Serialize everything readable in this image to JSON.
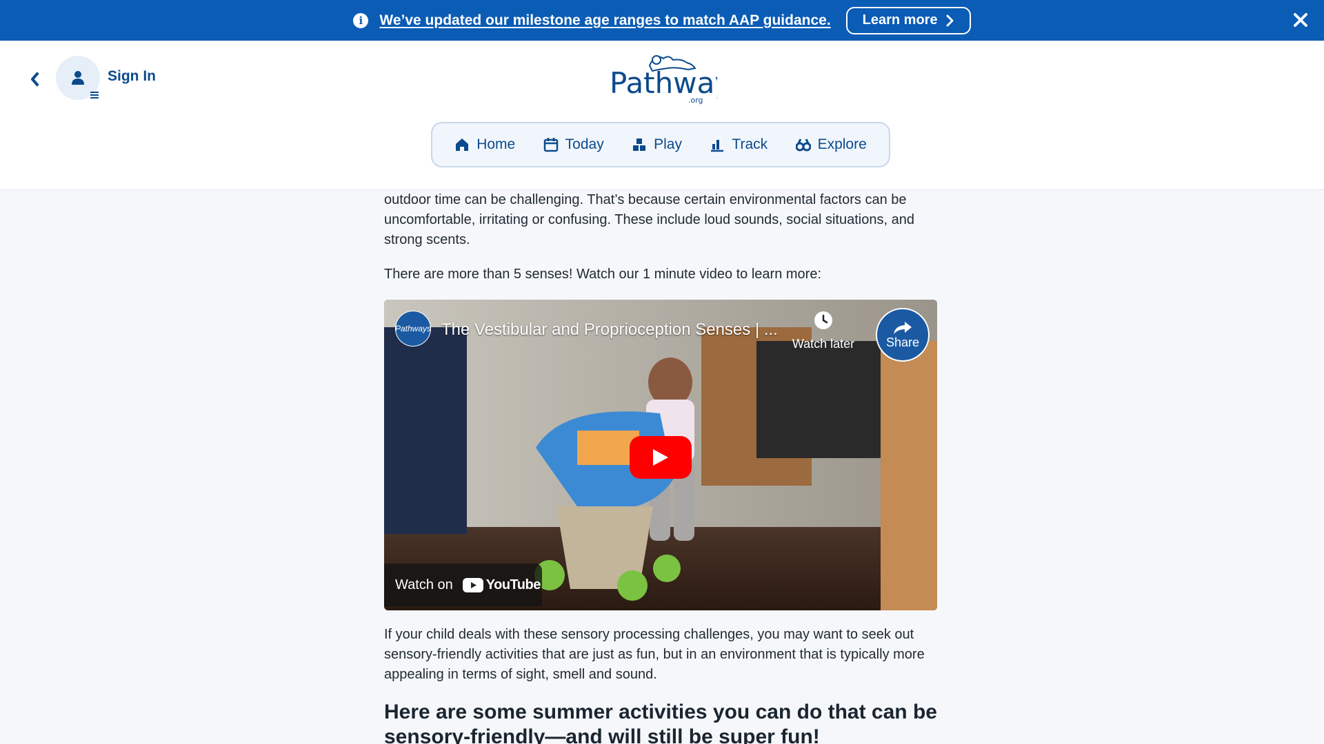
{
  "banner": {
    "message": "We’ve updated our milestone age ranges to match AAP guidance.",
    "cta_label": "Learn more",
    "bg_color": "#0a5cb5"
  },
  "header": {
    "signin_label": "Sign In",
    "logo_text": "Pathways",
    "logo_suffix": ".org",
    "nav": [
      {
        "label": "Home",
        "icon": "home-icon"
      },
      {
        "label": "Today",
        "icon": "calendar-icon"
      },
      {
        "label": "Play",
        "icon": "blocks-icon"
      },
      {
        "label": "Track",
        "icon": "chart-icon"
      },
      {
        "label": "Explore",
        "icon": "binoculars-icon"
      }
    ],
    "accent_color": "#0c4a8c"
  },
  "content": {
    "para1": "outdoor time can be challenging. That’s because certain environmental factors can be uncomfortable, irritating or confusing. These include loud sounds, social situations, and strong scents.",
    "para2": "There are more than 5 senses! Watch our 1 minute video to learn more:",
    "video": {
      "title": "The Vestibular and Proprioception Senses | ...",
      "watch_later": "Watch later",
      "share": "Share",
      "watch_on": "Watch on",
      "youtube": "YouTube",
      "channel_label": "Pathways"
    },
    "para3": "If your child deals with these sensory processing challenges, you may want to seek out sensory-friendly activities that are just as fun, but in an environment that is typically more appealing in terms of sight, smell and sound.",
    "heading": "Here are some summer activities you can do that can be sensory-friendly—and will still be super fun!"
  }
}
